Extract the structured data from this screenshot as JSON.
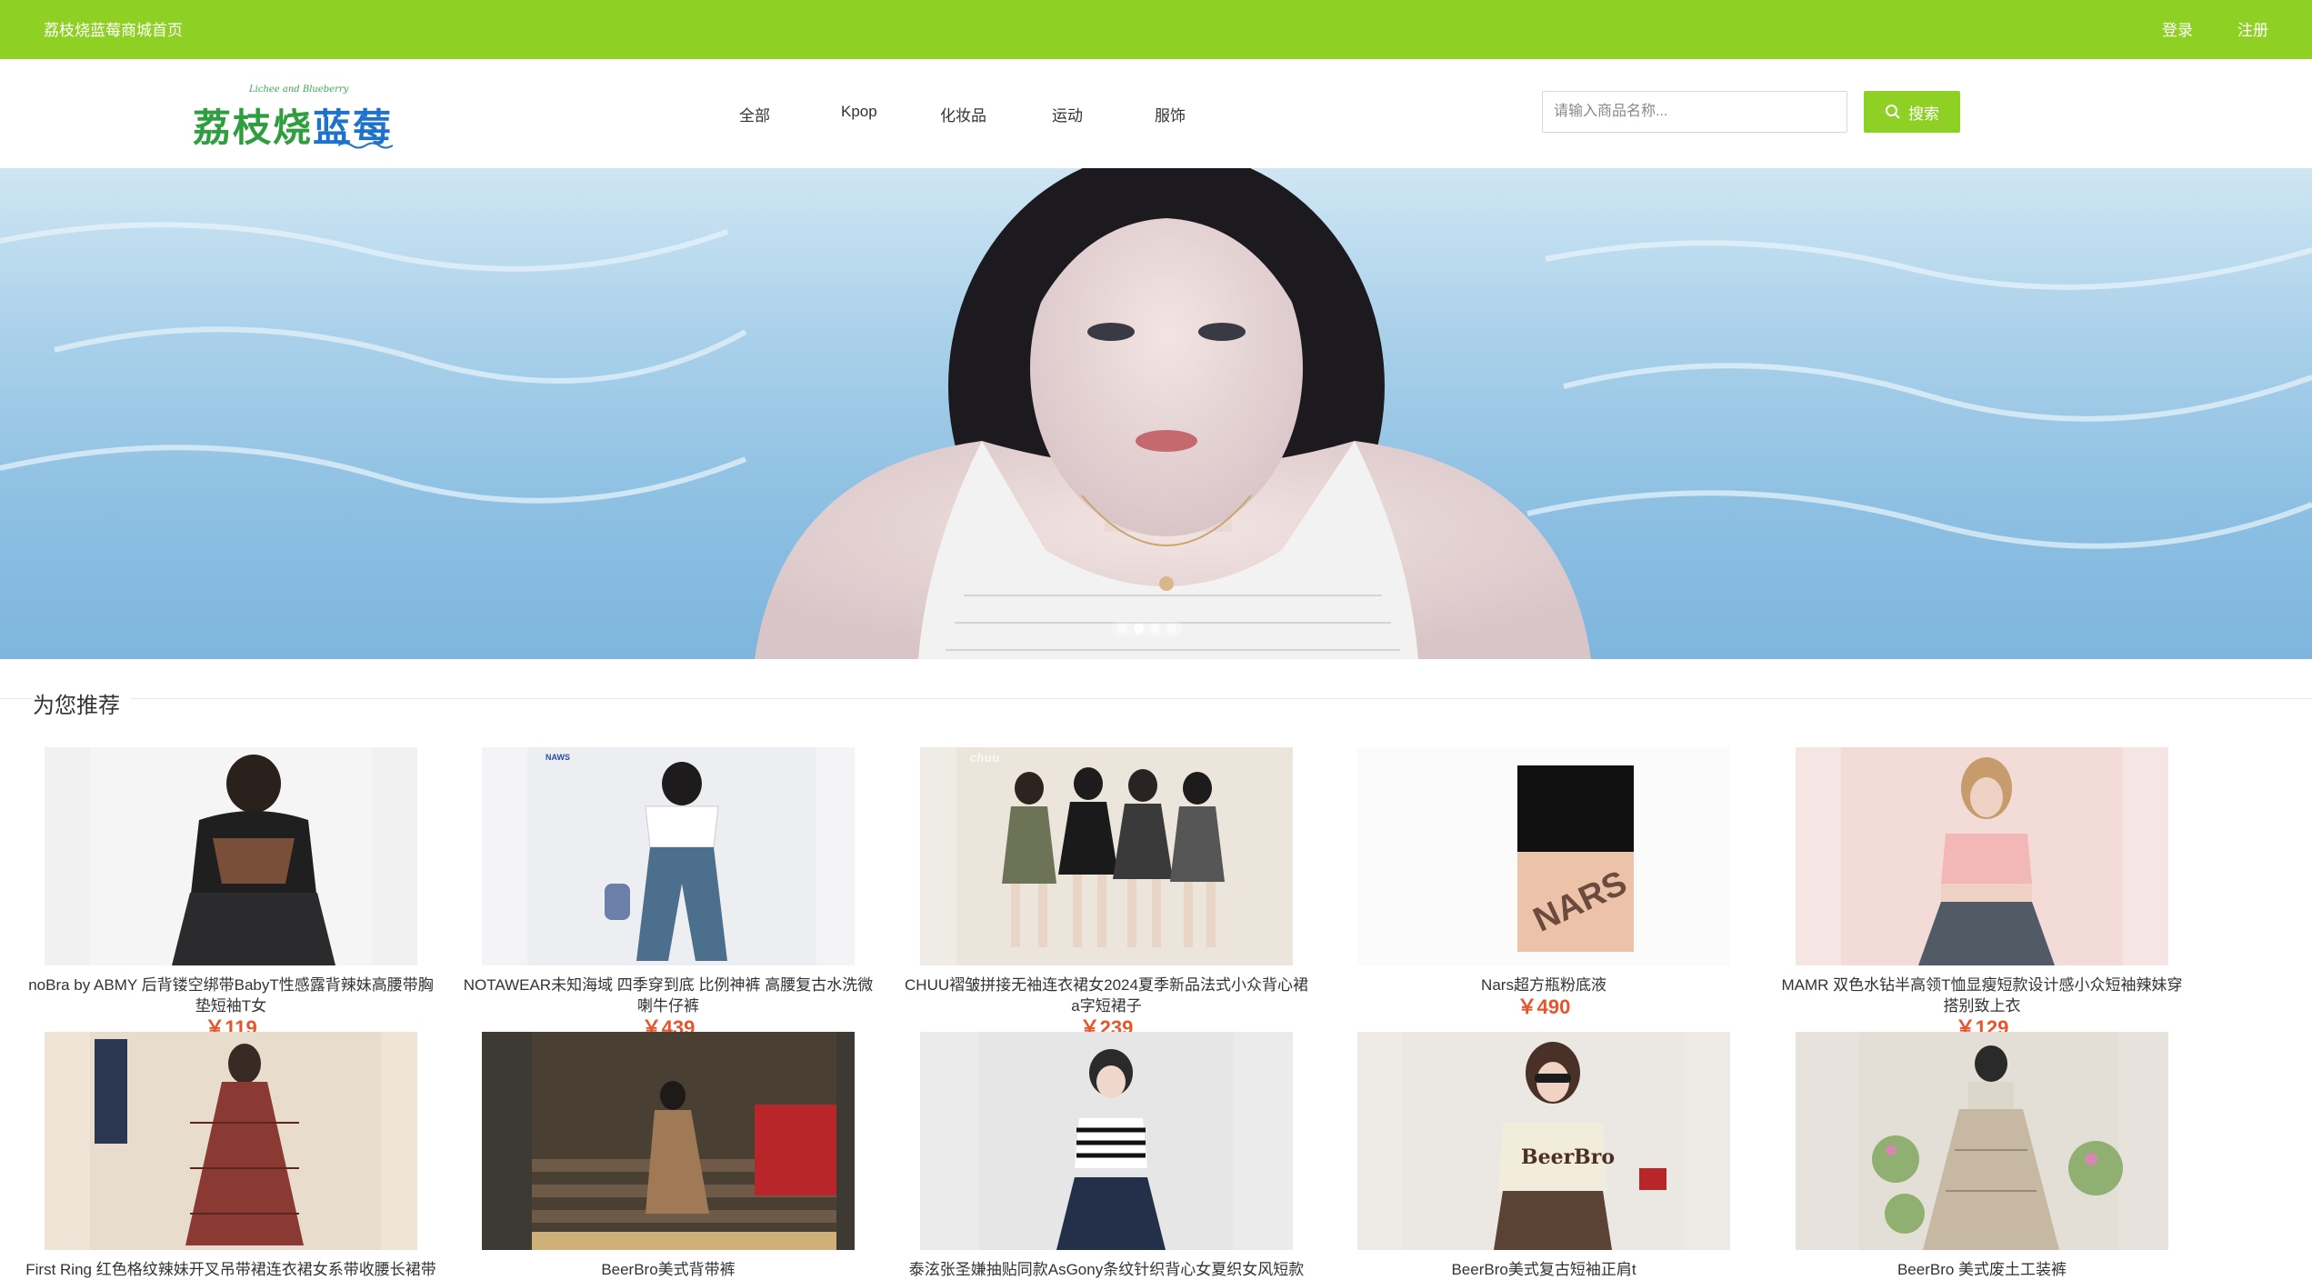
{
  "topbar": {
    "site_title": "荔枝烧蓝莓商城首页",
    "login": "登录",
    "register": "注册"
  },
  "logo": {
    "subtitle": "Lichee and Blueberry",
    "main_green": "荔枝烧",
    "main_blue": "蓝莓"
  },
  "nav": {
    "items": [
      {
        "label": "全部"
      },
      {
        "label": "Kpop"
      },
      {
        "label": "化妆品"
      },
      {
        "label": "运动"
      },
      {
        "label": "服饰"
      }
    ]
  },
  "search": {
    "placeholder": "请输入商品名称...",
    "button_label": "搜索"
  },
  "banner": {
    "dots": 4,
    "active_dot": 1
  },
  "section": {
    "title": "为您推荐"
  },
  "products": [
    {
      "name": "noBra by ABMY 后背镂空绑带BabyT性感露背辣妹高腰带胸垫短袖T女",
      "price": "￥119"
    },
    {
      "name": "NOTAWEAR未知海域 四季穿到底 比例神裤 高腰复古水洗微喇牛仔裤",
      "price": "￥439"
    },
    {
      "name": "CHUU褶皱拼接无袖连衣裙女2024夏季新品法式小众背心裙a字短裙子",
      "price": "￥239"
    },
    {
      "name": "Nars超方瓶粉底液",
      "price": "￥490"
    },
    {
      "name": "MAMR 双色水钻半高领T恤显瘦短款设计感小众短袖辣妹穿搭别致上衣",
      "price": "￥129"
    },
    {
      "name": "First Ring 红色格纹辣妹开叉吊带裙连衣裙女系带收腰长裙带",
      "price": ""
    },
    {
      "name": "BeerBro美式背带裤",
      "price": ""
    },
    {
      "name": "泰泫张圣嫌抽贴同款AsGony条纹针织背心女夏织女风短款",
      "price": ""
    },
    {
      "name": "BeerBro美式复古短袖正肩t",
      "price": ""
    },
    {
      "name": "BeerBro 美式废土工装裤",
      "price": ""
    }
  ]
}
